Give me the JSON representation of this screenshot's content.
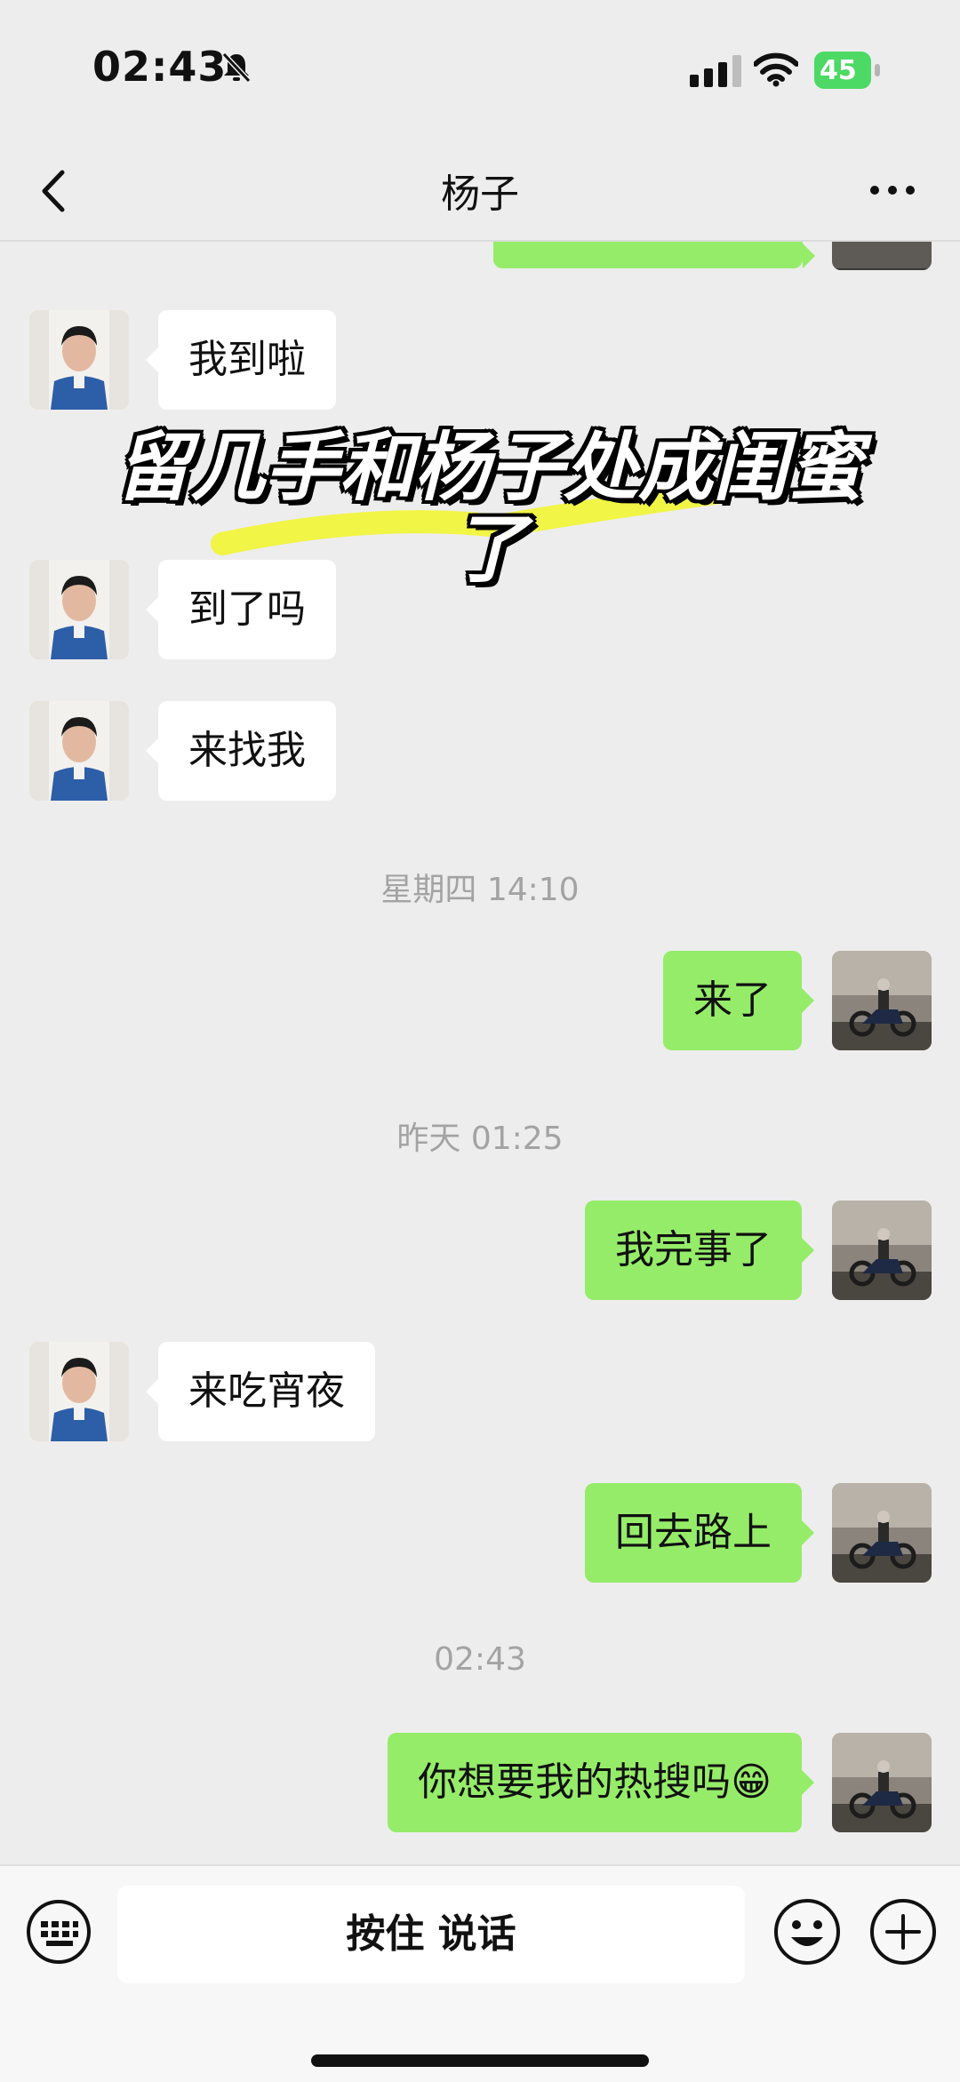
{
  "status_bar": {
    "time": "02:43",
    "battery": "45"
  },
  "nav": {
    "title": "杨子"
  },
  "overlay": {
    "caption_line1": "留几手和杨子处成闺蜜",
    "caption_line2": "了"
  },
  "messages": [
    {
      "side": "in",
      "text": "我到啦"
    },
    {
      "side": "in",
      "text": "到了吗"
    },
    {
      "side": "in",
      "text": "来找我"
    },
    {
      "type": "time",
      "text": "星期四 14:10"
    },
    {
      "side": "out",
      "text": "来了"
    },
    {
      "type": "time",
      "text": "昨天 01:25"
    },
    {
      "side": "out",
      "text": "我完事了"
    },
    {
      "side": "in",
      "text": "来吃宵夜"
    },
    {
      "side": "out",
      "text": "回去路上"
    },
    {
      "type": "time",
      "text": "02:43"
    },
    {
      "side": "out",
      "text": "你想要我的热搜吗😁"
    }
  ],
  "input_bar": {
    "hold_to_talk": "按住 说话"
  },
  "colors": {
    "background": "#ededed",
    "outgoing_bubble": "#95ec69",
    "incoming_bubble": "#ffffff",
    "timestamp_text": "#a3a3a3",
    "highlight": "#f1f532"
  }
}
